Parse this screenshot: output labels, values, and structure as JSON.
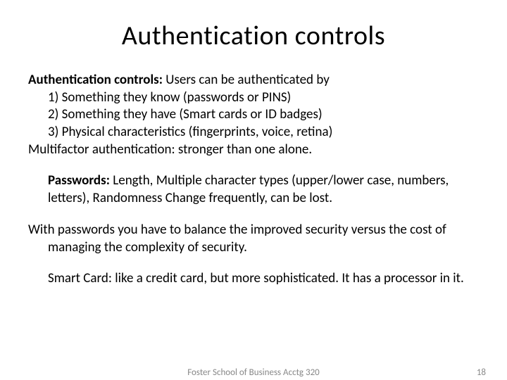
{
  "title": "Authentication controls",
  "auth_label": "Authentication controls:",
  "auth_intro": "  Users can be authenticated by",
  "items": [
    "1)  Something they know (passwords or PINS)",
    "2)  Something they have (Smart cards or ID badges)",
    "3)  Physical characteristics (fingerprints, voice, retina)"
  ],
  "multifactor": "Multifactor authentication: stronger than one alone.",
  "passwords_label": "Passwords:",
  "passwords_text": "  Length,  Multiple character types (upper/lower case, numbers, letters), Randomness Change frequently, can be lost.",
  "balance_line1": "With passwords you have to balance the improved security versus the cost of",
  "balance_line2": "managing the complexity of security.",
  "smartcard": "Smart Card:  like a credit card, but more sophisticated.  It has a processor in it.",
  "footer_center": "Foster School of Business      Acctg 320",
  "footer_right": "18"
}
